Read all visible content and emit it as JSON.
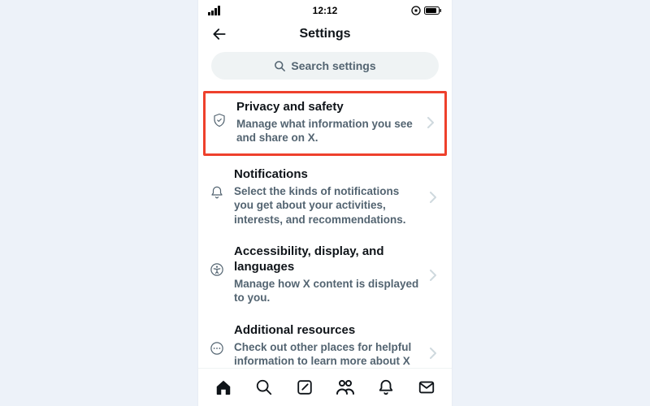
{
  "status": {
    "time": "12:12"
  },
  "header": {
    "title": "Settings"
  },
  "search": {
    "placeholder": "Search settings"
  },
  "items": [
    {
      "title": "Privacy and safety",
      "desc": "Manage what information you see and share on X."
    },
    {
      "title": "Notifications",
      "desc": "Select the kinds of notifications you get about your activities, interests, and recommendations."
    },
    {
      "title": "Accessibility, display, and languages",
      "desc": "Manage how X content is displayed to you."
    },
    {
      "title": "Additional resources",
      "desc": "Check out other places for helpful information to learn more about X products and services."
    }
  ],
  "highlight_index": 0,
  "colors": {
    "highlight_border": "#ee402c",
    "text_muted": "#536471",
    "text": "#0f1419",
    "search_bg": "#eff3f4"
  }
}
